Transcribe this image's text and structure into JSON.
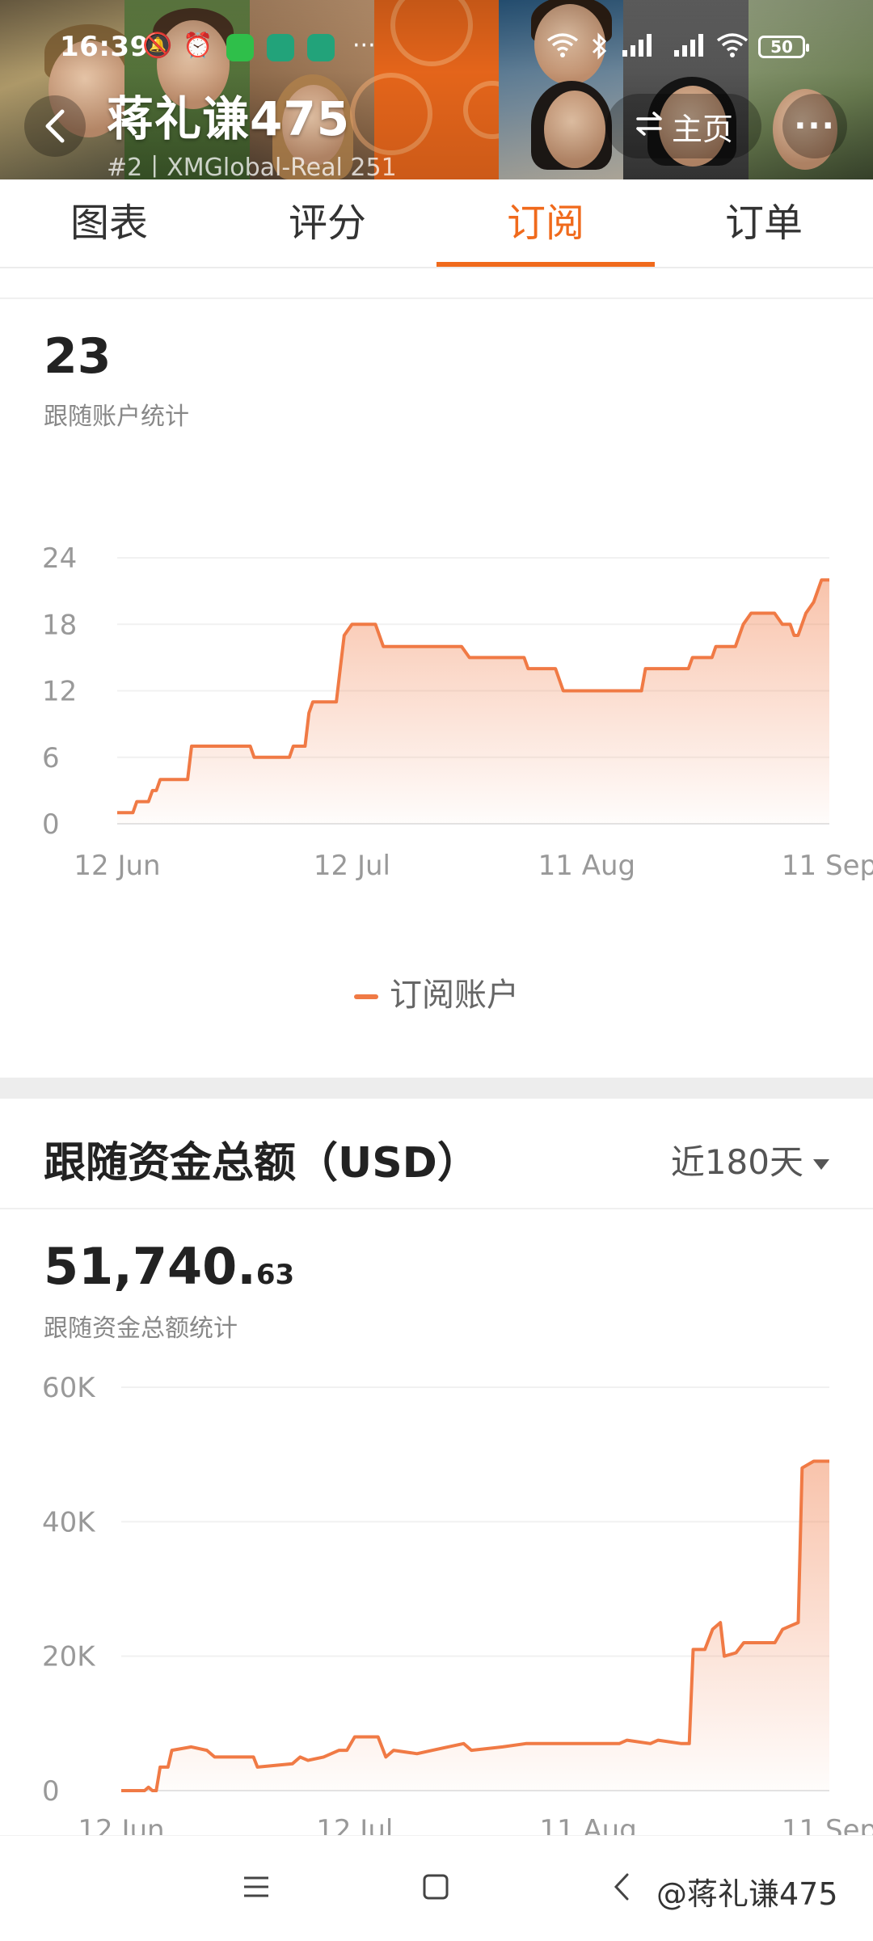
{
  "status_bar": {
    "time": "16:39",
    "battery": "50"
  },
  "header": {
    "title": "蒋礼谦475",
    "subtitle": "#2丨XMGlobal-Real 251",
    "home_label": "主页"
  },
  "tabs": [
    {
      "label": "图表"
    },
    {
      "label": "评分"
    },
    {
      "label": "订阅"
    },
    {
      "label": "订单"
    }
  ],
  "subscription": {
    "value": "23",
    "caption": "跟随账户统计",
    "legend": "订阅账户"
  },
  "funds": {
    "title": "跟随资金总额（USD）",
    "range": "近180天",
    "value_int": "51,740.",
    "value_dec": "63",
    "caption": "跟随资金总额统计"
  },
  "watermark": "@蒋礼谦475",
  "colors": {
    "accent": "#f06a1c",
    "line": "#f07a45"
  },
  "chart_data": [
    {
      "type": "area",
      "title": "",
      "y_ticks": [
        "0",
        "6",
        "12",
        "18",
        "24"
      ],
      "ylim": [
        0,
        24
      ],
      "x_ticks": [
        "12 Jun",
        "12 Jul",
        "11 Aug",
        "11 Sep"
      ],
      "x_tick_days": [
        0,
        30,
        60,
        91
      ],
      "x_range_days": [
        0,
        91
      ],
      "series": [
        {
          "name": "订阅账户",
          "points": [
            [
              0,
              1
            ],
            [
              2,
              1
            ],
            [
              2.5,
              2
            ],
            [
              4,
              2
            ],
            [
              4.5,
              3
            ],
            [
              5,
              3
            ],
            [
              5.5,
              4
            ],
            [
              9,
              4
            ],
            [
              9.5,
              7
            ],
            [
              17,
              7
            ],
            [
              17.5,
              6
            ],
            [
              22,
              6
            ],
            [
              22.5,
              7
            ],
            [
              24,
              7
            ],
            [
              24.5,
              10
            ],
            [
              25,
              11
            ],
            [
              28,
              11
            ],
            [
              28.5,
              14
            ],
            [
              29,
              17
            ],
            [
              30,
              18
            ],
            [
              33,
              18
            ],
            [
              34,
              16
            ],
            [
              44,
              16
            ],
            [
              45,
              15
            ],
            [
              52,
              15
            ],
            [
              52.5,
              14
            ],
            [
              56,
              14
            ],
            [
              57,
              12
            ],
            [
              67,
              12
            ],
            [
              67.5,
              14
            ],
            [
              73,
              14
            ],
            [
              73.5,
              15
            ],
            [
              76,
              15
            ],
            [
              76.5,
              16
            ],
            [
              79,
              16
            ],
            [
              80,
              18
            ],
            [
              81,
              19
            ],
            [
              84,
              19
            ],
            [
              85,
              18
            ],
            [
              86,
              18
            ],
            [
              86.5,
              17
            ],
            [
              87,
              17
            ],
            [
              88,
              19
            ],
            [
              89,
              20
            ],
            [
              90,
              22
            ],
            [
              91,
              22
            ]
          ]
        }
      ]
    },
    {
      "type": "area",
      "title": "",
      "y_ticks": [
        "0",
        "20K",
        "40K",
        "60K"
      ],
      "ylim": [
        0,
        60000
      ],
      "x_ticks": [
        "12 Jun",
        "12 Jul",
        "11 Aug",
        "11 Sep"
      ],
      "x_tick_days": [
        0,
        30,
        60,
        91
      ],
      "x_range_days": [
        0,
        91
      ],
      "series": [
        {
          "name": "跟随资金总额",
          "points": [
            [
              0,
              0
            ],
            [
              3,
              0
            ],
            [
              3.5,
              500
            ],
            [
              4,
              0
            ],
            [
              4.5,
              0
            ],
            [
              5,
              3500
            ],
            [
              6,
              3500
            ],
            [
              6.5,
              6000
            ],
            [
              9,
              6500
            ],
            [
              11,
              6000
            ],
            [
              12,
              5000
            ],
            [
              17,
              5000
            ],
            [
              17.5,
              3500
            ],
            [
              22,
              4000
            ],
            [
              23,
              5000
            ],
            [
              24,
              4500
            ],
            [
              26,
              5000
            ],
            [
              28,
              6000
            ],
            [
              29,
              6000
            ],
            [
              30,
              8000
            ],
            [
              33,
              8000
            ],
            [
              34,
              5000
            ],
            [
              35,
              6000
            ],
            [
              38,
              5500
            ],
            [
              40,
              6000
            ],
            [
              42,
              6500
            ],
            [
              44,
              7000
            ],
            [
              45,
              6000
            ],
            [
              49,
              6500
            ],
            [
              52,
              7000
            ],
            [
              56,
              7000
            ],
            [
              60,
              7000
            ],
            [
              64,
              7000
            ],
            [
              65,
              7500
            ],
            [
              68,
              7000
            ],
            [
              69,
              7500
            ],
            [
              72,
              7000
            ],
            [
              73,
              7000
            ],
            [
              73.5,
              21000
            ],
            [
              75,
              21000
            ],
            [
              76,
              24000
            ],
            [
              77,
              25000
            ],
            [
              77.5,
              20000
            ],
            [
              79,
              20500
            ],
            [
              80,
              22000
            ],
            [
              82,
              22000
            ],
            [
              84,
              22000
            ],
            [
              85,
              24000
            ],
            [
              86,
              24500
            ],
            [
              87,
              25000
            ],
            [
              87.5,
              48000
            ],
            [
              89,
              49000
            ],
            [
              91,
              49000
            ]
          ]
        }
      ]
    }
  ]
}
